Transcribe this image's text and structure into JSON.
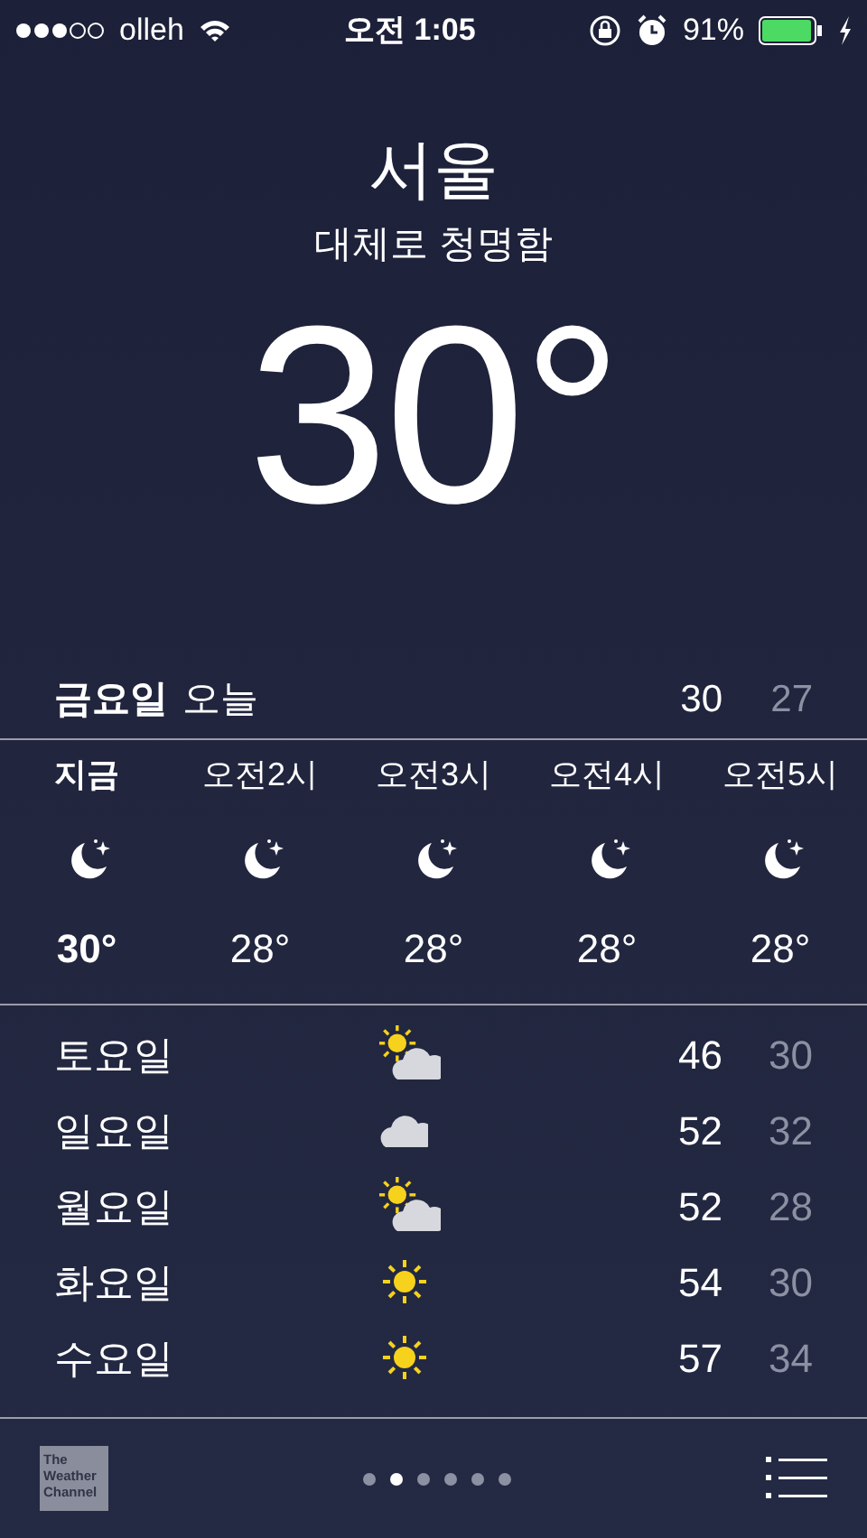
{
  "status_bar": {
    "carrier": "olleh",
    "time": "오전 1:05",
    "battery": "91%"
  },
  "location": {
    "city": "서울",
    "condition": "대체로 청명함",
    "temperature": "30°"
  },
  "today": {
    "day": "금요일",
    "label": "오늘",
    "high": "30",
    "low": "27"
  },
  "hourly": [
    {
      "time": "지금",
      "kind": "moon",
      "temp": "30°",
      "now": true
    },
    {
      "time": "오전2시",
      "kind": "moon",
      "temp": "28°",
      "now": false
    },
    {
      "time": "오전3시",
      "kind": "moon",
      "temp": "28°",
      "now": false
    },
    {
      "time": "오전4시",
      "kind": "moon",
      "temp": "28°",
      "now": false
    },
    {
      "time": "오전5시",
      "kind": "moon",
      "temp": "28°",
      "now": false
    }
  ],
  "daily": [
    {
      "day": "토요일",
      "kind": "partly-cloudy",
      "high": "46",
      "low": "30"
    },
    {
      "day": "일요일",
      "kind": "cloudy",
      "high": "52",
      "low": "32"
    },
    {
      "day": "월요일",
      "kind": "partly-cloudy",
      "high": "52",
      "low": "28"
    },
    {
      "day": "화요일",
      "kind": "sunny",
      "high": "54",
      "low": "30"
    },
    {
      "day": "수요일",
      "kind": "sunny",
      "high": "57",
      "low": "34"
    }
  ],
  "footer": {
    "logo": [
      "The",
      "Weather",
      "Channel"
    ],
    "pages": [
      {
        "selected": false
      },
      {
        "selected": true
      },
      {
        "selected": false
      },
      {
        "selected": false
      },
      {
        "selected": false
      },
      {
        "selected": false
      }
    ]
  }
}
